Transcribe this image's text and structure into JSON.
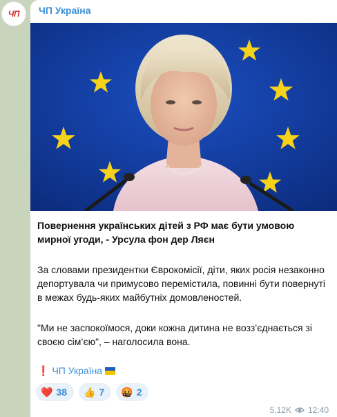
{
  "channel": {
    "avatar_text": "ЧП",
    "name": "ЧП Україна"
  },
  "post": {
    "title": "Повернення українських дітей з РФ має бути умовою мирної угоди, - Урсула фон дер Ляєн",
    "paragraph1": "За словами президентки Єврокомісії, діти, яких росія незаконно депортувала чи примусово перемістила, повинні бути повернуті в межах будь-яких майбутніх домовленостей.",
    "paragraph2": "\"Ми не заспокоїмося, доки кожна дитина не возз’єднається зі своєю сім’єю\", – наголосила вона.",
    "signature_mark": "❗",
    "signature_text": "ЧП Україна"
  },
  "reactions": [
    {
      "emoji": "❤️",
      "count": "38"
    },
    {
      "emoji": "👍",
      "count": "7"
    },
    {
      "emoji": "🤬",
      "count": "2"
    }
  ],
  "meta": {
    "views": "5.12K",
    "time": "12:40"
  },
  "colors": {
    "accent": "#3a8fd6",
    "flag_blue": "#1f5fbf",
    "flag_yellow": "#f5c400"
  }
}
